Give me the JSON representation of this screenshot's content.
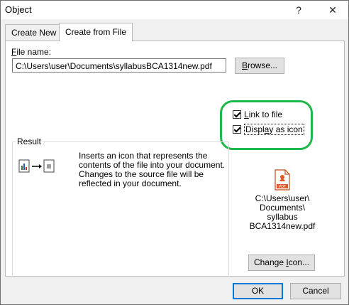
{
  "window": {
    "title": "Object",
    "help_glyph": "?",
    "close_glyph": "✕"
  },
  "tabs": [
    {
      "label": "Create New",
      "active": false
    },
    {
      "label": "Create from File",
      "active": true
    }
  ],
  "file": {
    "label": "File name:",
    "value": "C:\\Users\\user\\Documents\\syllabusBCA1314new.pdf",
    "browse_label": "Browse..."
  },
  "options": {
    "link_to_file": {
      "label": "Link to file",
      "checked": true
    },
    "display_as_icon": {
      "label": "Display as icon",
      "checked": true
    },
    "highlight_color": "#1db84a"
  },
  "result": {
    "title": "Result",
    "description_lines": [
      "Inserts an icon that represents the",
      "contents of the file into your document.",
      "Changes to the source file will be",
      "reflected in your document."
    ]
  },
  "icon_preview": {
    "icon": "pdf-file-icon",
    "badge": "PDF",
    "caption_lines": [
      "C:\\Users\\user\\",
      "Documents\\",
      "syllabus",
      "BCA1314new.pdf"
    ],
    "change_icon_label": "Change Icon..."
  },
  "footer": {
    "ok_label": "OK",
    "cancel_label": "Cancel"
  }
}
